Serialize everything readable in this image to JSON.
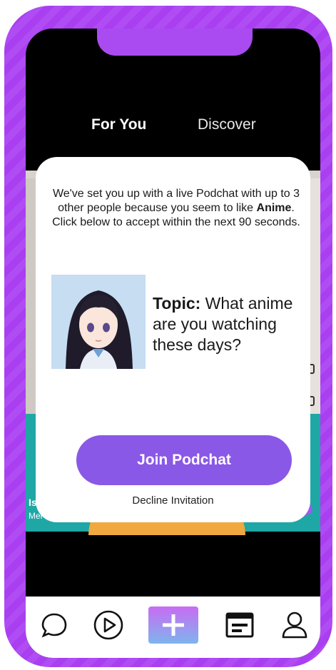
{
  "top_tabs": {
    "for_you": "For You",
    "discover": "Discover"
  },
  "feed": {
    "side_title": "Is",
    "side_subtitle": "Mel"
  },
  "modal": {
    "invite_text_before": "We've set you up with a live Podchat with up to 3 other people because you seem to like ",
    "invite_interest": "Anime",
    "invite_text_after": ". Click below to accept within the next 90 seconds.",
    "topic_label": "Topic:",
    "topic_text": " What anime are you watching these days?",
    "join_button": "Join Podchat",
    "decline_link": "Decline Invitation"
  },
  "bottom_nav": {
    "items": [
      {
        "icon": "chat-bubble-icon"
      },
      {
        "icon": "play-circle-icon"
      },
      {
        "icon": "plus-icon"
      },
      {
        "icon": "feed-card-icon"
      },
      {
        "icon": "profile-icon"
      }
    ]
  },
  "colors": {
    "phone_frame": "#a93ff0",
    "join_button": "#8a58e6",
    "create_gradient_top": "#c86cf2",
    "create_gradient_bottom": "#7fb4ee"
  }
}
